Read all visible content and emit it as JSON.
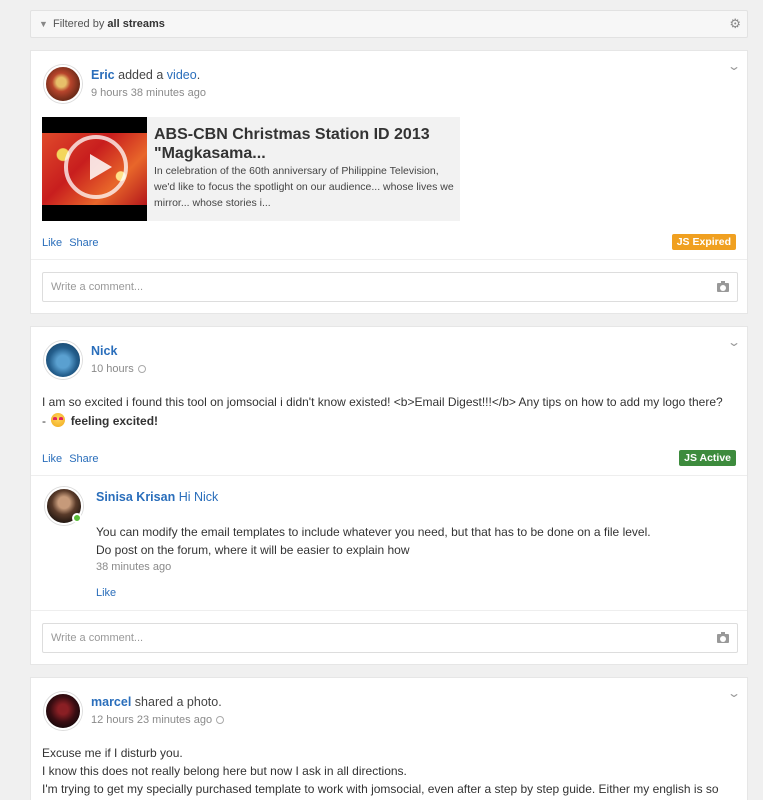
{
  "filter": {
    "prefix": "Filtered by",
    "value": "all streams"
  },
  "posts": [
    {
      "author": "Eric",
      "action_prefix": "added a",
      "action_link": "video",
      "action_suffix": ".",
      "time": "9 hours 38 minutes ago",
      "video": {
        "title": "ABS-CBN Christmas Station ID 2013 \"Magkasama...",
        "description": "In celebration of the 60th anniversary of Philippine Television, we'd like to focus the spotlight on our audience... whose lives we mirror... whose stories i..."
      },
      "like": "Like",
      "share": "Share",
      "badge": "JS Expired",
      "comment_placeholder": "Write a comment..."
    },
    {
      "author": "Nick",
      "time": "10 hours",
      "text": "I am so excited i found this tool on jomsocial i didn't know existed! <b>Email Digest!!!</b> Any tips on how to add my logo there?",
      "feeling_prefix": "-",
      "feeling": "feeling excited!",
      "like": "Like",
      "share": "Share",
      "badge": "JS Active",
      "reply": {
        "author": "Sinisa Krisan",
        "greeting": "Hi Nick",
        "line1": "You can modify the email templates to include whatever you need, but that has to be done on a file level.",
        "line2": "Do post on the forum, where it will be easier to explain how",
        "time": "38 minutes ago",
        "like": "Like"
      },
      "comment_placeholder": "Write a comment..."
    },
    {
      "author": "marcel",
      "action_prefix": "shared a photo.",
      "time": "12 hours 23 minutes ago",
      "line1": "Excuse me if I disturb you.",
      "line2": "I know this does not really belong here but now I ask in all directions.",
      "line3": "I'm trying to get my specially purchased template to work with jomsocial, even after a step by step guide. Either my english is so"
    }
  ],
  "colors": {
    "link": "#2a6ebb",
    "badge_expired": "#f0a020",
    "badge_active": "#3d8b3d"
  }
}
